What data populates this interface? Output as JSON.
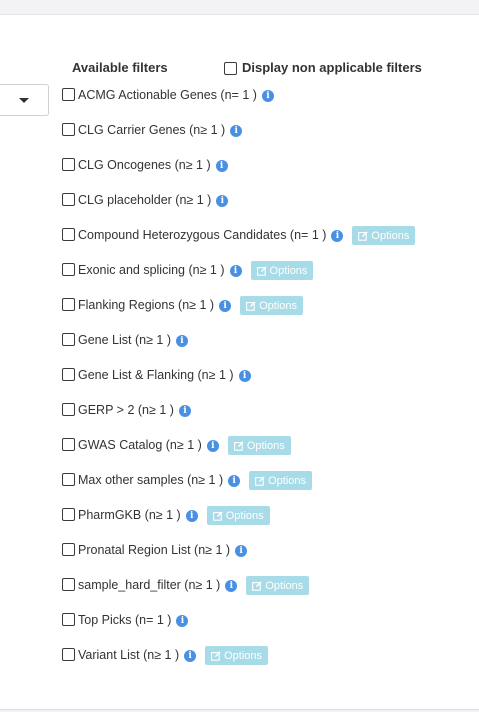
{
  "header": {
    "title": "Available filters",
    "non_applicable_label": "Display non applicable filters"
  },
  "filters": [
    {
      "label": "ACMG Actionable Genes (n= 1 )",
      "options": false
    },
    {
      "label": "CLG Carrier Genes (n≥ 1 )",
      "options": false
    },
    {
      "label": "CLG Oncogenes (n≥ 1 )",
      "options": false
    },
    {
      "label": "CLG placeholder (n≥ 1 )",
      "options": false
    },
    {
      "label": "Compound Heterozygous Candidates (n= 1 )",
      "options": true
    },
    {
      "label": "Exonic and splicing (n≥ 1 )",
      "options": true
    },
    {
      "label": "Flanking Regions (n≥ 1 )",
      "options": true
    },
    {
      "label": "Gene List (n≥ 1 )",
      "options": false
    },
    {
      "label": "Gene List & Flanking (n≥ 1 )",
      "options": false
    },
    {
      "label": "GERP > 2 (n≥ 1 )",
      "options": false
    },
    {
      "label": "GWAS Catalog (n≥ 1 )",
      "options": true
    },
    {
      "label": "Max other samples (n≥ 1 )",
      "options": true
    },
    {
      "label": "PharmGKB (n≥ 1 )",
      "options": true
    },
    {
      "label": "Pronatal Region List (n≥ 1 )",
      "options": false
    },
    {
      "label": "sample_hard_filter (n≥ 1 )",
      "options": true
    },
    {
      "label": "Top Picks (n= 1 )",
      "options": false
    },
    {
      "label": "Variant List (n≥ 1 )",
      "options": true
    }
  ],
  "options_label": "Options",
  "icons": {
    "info": "info-icon",
    "edit": "edit-icon",
    "dropdown": "caret-down-icon"
  },
  "colors": {
    "info": "#4a90e2",
    "options_button": "#a8dbe8"
  }
}
